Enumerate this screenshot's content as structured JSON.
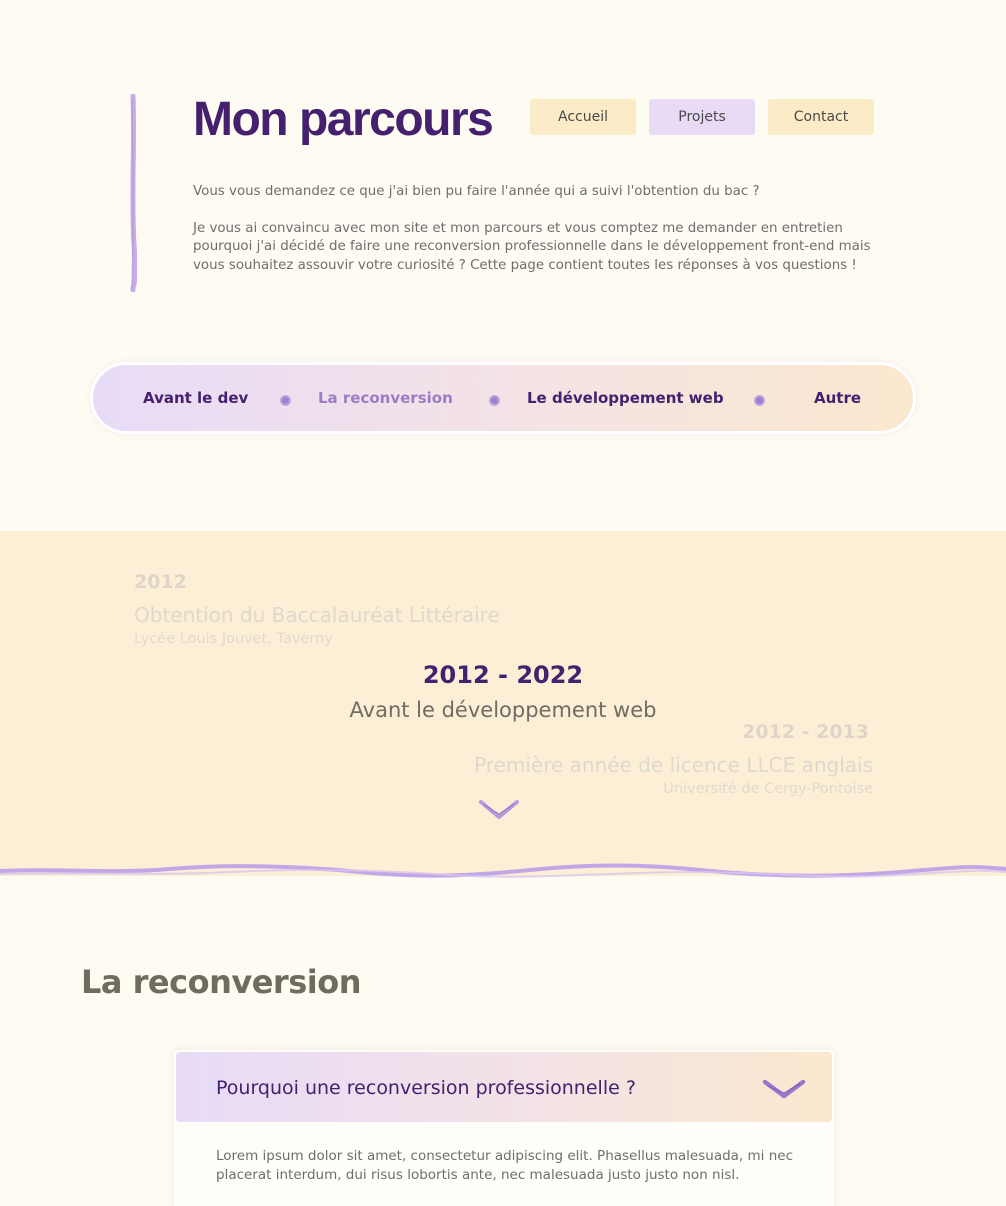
{
  "header": {
    "title": "Mon parcours",
    "nav": [
      {
        "label": "Accueil",
        "active": false
      },
      {
        "label": "Projets",
        "active": true
      },
      {
        "label": "Contact",
        "active": false
      }
    ],
    "intro": [
      "Vous vous demandez ce que j'ai bien pu faire l'année qui a suivi l'obtention du bac ?",
      "Je vous ai convaincu avec mon site et mon parcours et vous comptez me demander en entretien pourquoi j'ai décidé de faire une reconversion professionnelle dans le développement front-end mais vous souhaitez assouvir votre curiosité ? Cette page contient toutes les réponses à vos questions !"
    ]
  },
  "section_nav": {
    "items": [
      {
        "label": "Avant le dev",
        "active": false
      },
      {
        "label": "La reconversion",
        "active": true
      },
      {
        "label": "Le développement web",
        "active": false
      },
      {
        "label": "Autre",
        "active": false
      }
    ]
  },
  "timeline": {
    "period": "2012 - 2022",
    "period_title": "Avant le développement web",
    "entries": [
      {
        "year": "2012",
        "title": "Obtention du Baccalauréat Littéraire",
        "place": "Lycée Louis Jouvet, Taverny"
      },
      {
        "year": "2012 - 2013",
        "title": "Première année de licence LLCE anglais",
        "place": "Université de Cergy-Pontoise"
      }
    ]
  },
  "reconversion": {
    "title": "La reconversion",
    "accordion": {
      "question": "Pourquoi une reconversion professionnelle ?",
      "answer": "Lorem ipsum dolor sit amet, consectetur adipiscing elit. Phasellus malesuada, mi nec placerat interdum, dui risus lobortis ante, nec malesuada justo justo non nisl."
    }
  },
  "colors": {
    "accent_purple": "#44206f",
    "light_purple": "#9d7cc7",
    "cream": "#fefbf3",
    "peach": "#fcefd5"
  }
}
